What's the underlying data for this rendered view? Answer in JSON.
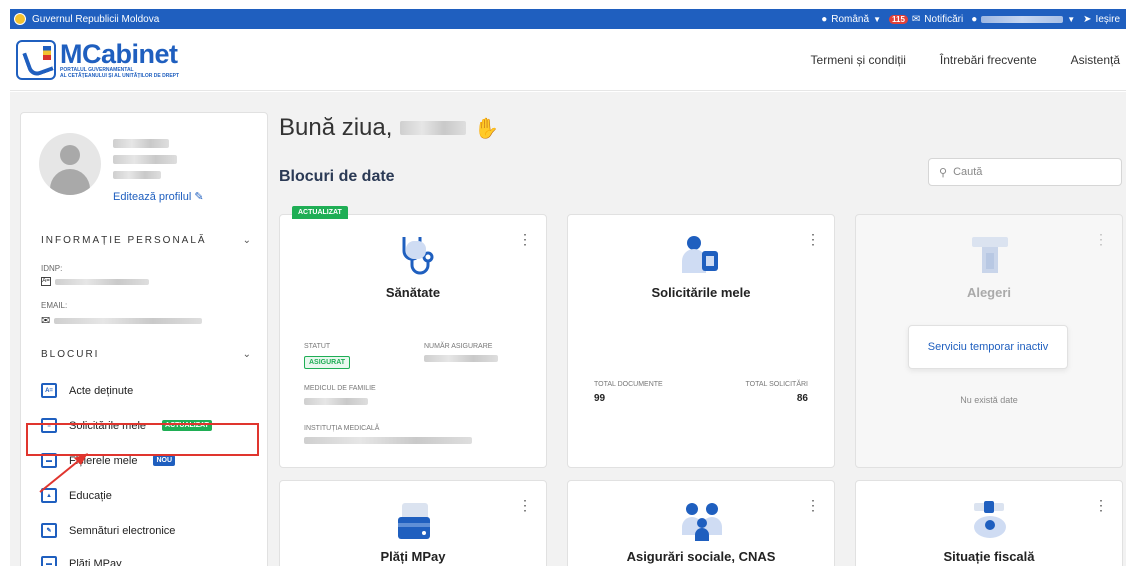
{
  "gov_bar": {
    "title": "Guvernul Republicii Moldova",
    "language": "Română",
    "notif_count": "115",
    "notif_label": "Notificări",
    "logout": "Ieșire"
  },
  "header": {
    "brand": "MCabinet",
    "subtitle_1": "PORTALUL GUVERNAMENTAL",
    "subtitle_2": "AL CETĂȚEANULUI ȘI AL UNITĂȚILOR DE DREPT",
    "links": [
      "Termeni și condiții",
      "Întrebări frecvente",
      "Asistență"
    ]
  },
  "sidebar": {
    "edit_profile": "Editează profilul",
    "personal_title": "INFORMAȚIE PERSONALĂ",
    "idnp_label": "IDNP:",
    "email_label": "EMAIL:",
    "blocks_title": "BLOCURI",
    "items": [
      {
        "label": "Acte deținute",
        "icon": "id-card-icon"
      },
      {
        "label": "Solicitările mele",
        "badge": "ACTUALIZAT",
        "icon": "document-icon"
      },
      {
        "label": "Fișierele mele",
        "badge": "NOU",
        "icon": "inbox-tray-icon"
      },
      {
        "label": "Educație",
        "icon": "graduation-cap-icon"
      },
      {
        "label": "Semnături electronice",
        "icon": "signature-icon"
      },
      {
        "label": "Plăți MPay",
        "icon": "payment-card-icon"
      }
    ]
  },
  "content": {
    "greeting": "Bună ziua,",
    "blocks_title": "Blocuri de date",
    "search_placeholder": "Caută",
    "updated_tag": "ACTUALIZAT",
    "cards": {
      "sanatate": {
        "title": "Sănătate",
        "statut_label": "STATUT",
        "statut_value": "ASIGURAT",
        "numar_label": "NUMĂR ASIGURARE",
        "medic_label": "MEDICUL DE FAMILIE",
        "institutie_label": "INSTITUȚIA MEDICALĂ"
      },
      "solicitari": {
        "title": "Solicitările mele",
        "total_doc_label": "TOTAL DOCUMENTE",
        "total_doc_value": "99",
        "total_sol_label": "TOTAL SOLICITĂRI",
        "total_sol_value": "86"
      },
      "alegeri": {
        "title": "Alegeri",
        "inactive": "Serviciu temporar inactiv",
        "no_data": "Nu există date"
      },
      "mpay": {
        "title": "Plăți MPay"
      },
      "cnas": {
        "title": "Asigurări sociale, CNAS"
      },
      "fiscal": {
        "title": "Situație fiscală"
      }
    }
  },
  "colors": {
    "primary": "#1f5fbf",
    "green": "#1fae55",
    "highlight_red": "#e0352e"
  }
}
